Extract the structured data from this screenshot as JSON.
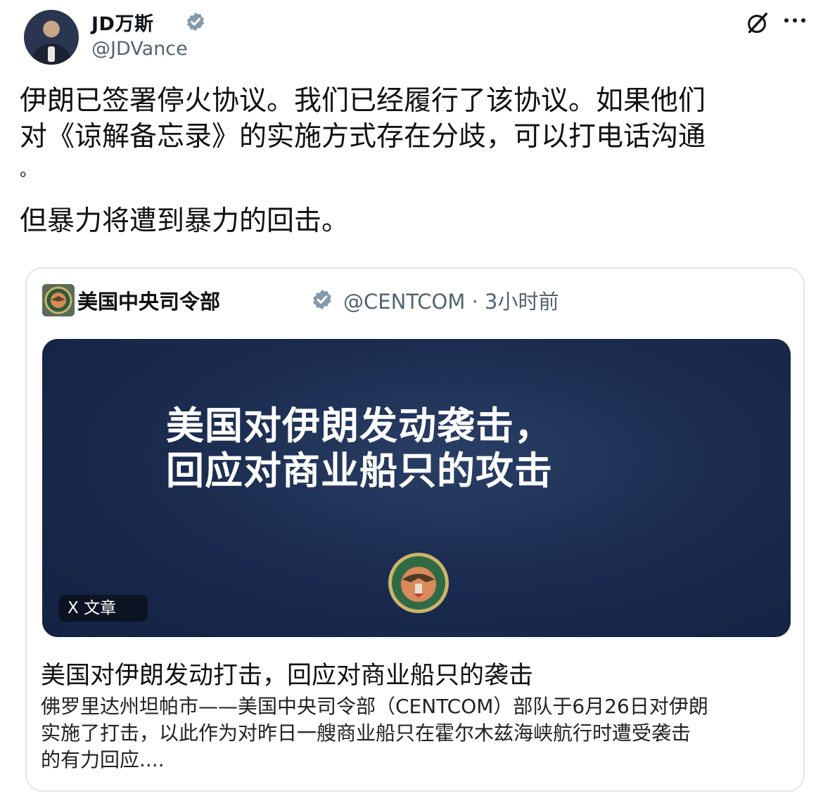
{
  "post": {
    "author_name": "JD万斯",
    "author_handle": "@JDVance",
    "verified": true,
    "text_paragraph_1_lines": [
      "伊朗已签署停火协议。我们已经履行了该协议。如果他们",
      "对《谅解备忘录》的实施方式存在分歧，可以打电话沟通",
      "。"
    ],
    "text_paragraph_2": "但暴力将遭到暴力的回击。"
  },
  "quote": {
    "author_name": "美国中央司令部",
    "author_handle": "@CENTCOM",
    "separator": "·",
    "time": "3小时前",
    "media": {
      "headline_lines": [
        "美国对伊朗发动袭击，",
        "回应对商业船只的攻击"
      ],
      "badge": "X 文章"
    },
    "article_title": "美国对伊朗发动打击，回应对商业船只的袭击",
    "article_desc_lines": [
      "佛罗里达州坦帕市——美国中央司令部（CENTCOM）部队于6月26日对伊朗",
      "实施了打击，以此作为对昨日一艘商业船只在霍尔木兹海峡航行时遭受袭击",
      "的有力回应...."
    ]
  },
  "icons": {
    "verified": "verified-badge-icon",
    "grok": "grok-icon",
    "more": "more-options-icon"
  },
  "colors": {
    "text": "#0f1419",
    "secondary": "#536471",
    "verified_badge": "#829aab",
    "media_bg": "#1b2c50"
  }
}
